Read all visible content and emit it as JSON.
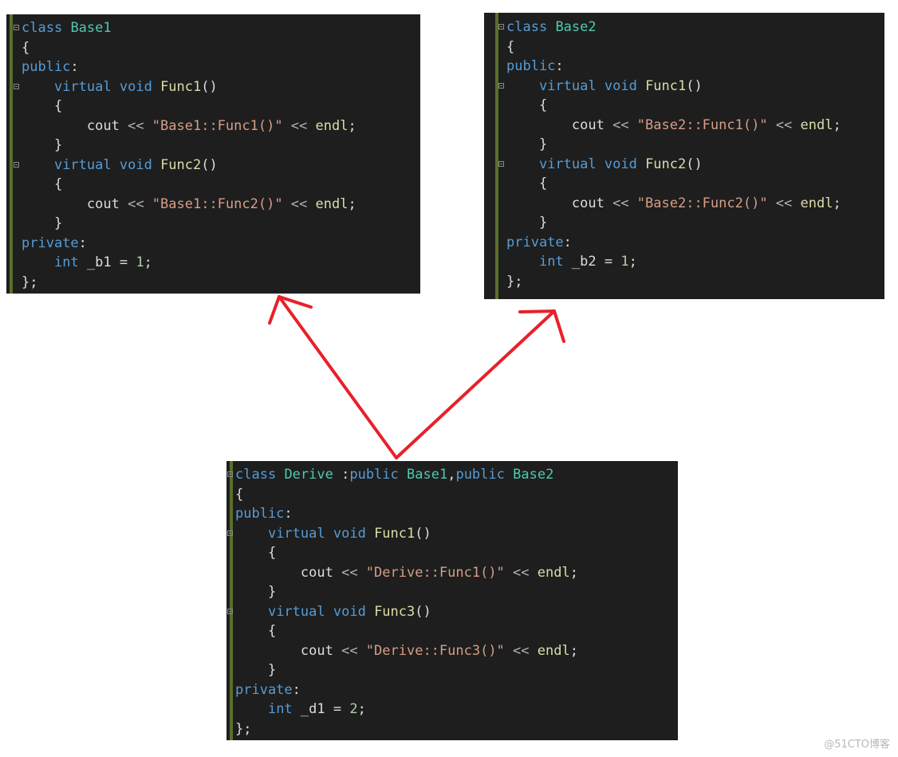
{
  "panels": [
    {
      "id": "base1",
      "lines": [
        [
          {
            "t": "class",
            "c": "kw"
          },
          {
            "t": " "
          },
          {
            "t": "Base1",
            "c": "ty"
          }
        ],
        [
          {
            "t": "{"
          }
        ],
        [
          {
            "t": "public",
            "c": "kw"
          },
          {
            "t": ":"
          }
        ],
        [
          {
            "t": "    "
          },
          {
            "t": "virtual",
            "c": "kw"
          },
          {
            "t": " "
          },
          {
            "t": "void",
            "c": "kw"
          },
          {
            "t": " "
          },
          {
            "t": "Func1",
            "c": "fn"
          },
          {
            "t": "()"
          }
        ],
        [
          {
            "t": "    {"
          }
        ],
        [
          {
            "t": "        "
          },
          {
            "t": "cout",
            "c": "id"
          },
          {
            "t": " << ",
            "c": "op"
          },
          {
            "t": "\"Base1::Func1()\"",
            "c": "str"
          },
          {
            "t": " << ",
            "c": "op"
          },
          {
            "t": "endl",
            "c": "fn"
          },
          {
            "t": ";"
          }
        ],
        [
          {
            "t": "    }"
          }
        ],
        [
          {
            "t": "    "
          },
          {
            "t": "virtual",
            "c": "kw"
          },
          {
            "t": " "
          },
          {
            "t": "void",
            "c": "kw"
          },
          {
            "t": " "
          },
          {
            "t": "Func2",
            "c": "fn"
          },
          {
            "t": "()"
          }
        ],
        [
          {
            "t": "    {"
          }
        ],
        [
          {
            "t": "        "
          },
          {
            "t": "cout",
            "c": "id"
          },
          {
            "t": " << ",
            "c": "op"
          },
          {
            "t": "\"Base1::Func2()\"",
            "c": "str"
          },
          {
            "t": " << ",
            "c": "op"
          },
          {
            "t": "endl",
            "c": "fn"
          },
          {
            "t": ";"
          }
        ],
        [
          {
            "t": "    }"
          }
        ],
        [
          {
            "t": "private",
            "c": "kw"
          },
          {
            "t": ":"
          }
        ],
        [
          {
            "t": "    "
          },
          {
            "t": "int",
            "c": "kw"
          },
          {
            "t": " _b1 = "
          },
          {
            "t": "1",
            "c": "num"
          },
          {
            "t": ";"
          }
        ],
        [
          {
            "t": "};"
          }
        ]
      ]
    },
    {
      "id": "base2",
      "lines": [
        [
          {
            "t": "class",
            "c": "kw"
          },
          {
            "t": " "
          },
          {
            "t": "Base2",
            "c": "ty"
          }
        ],
        [
          {
            "t": "{"
          }
        ],
        [
          {
            "t": "public",
            "c": "kw"
          },
          {
            "t": ":"
          }
        ],
        [
          {
            "t": "    "
          },
          {
            "t": "virtual",
            "c": "kw"
          },
          {
            "t": " "
          },
          {
            "t": "void",
            "c": "kw"
          },
          {
            "t": " "
          },
          {
            "t": "Func1",
            "c": "fn"
          },
          {
            "t": "()"
          }
        ],
        [
          {
            "t": "    {"
          }
        ],
        [
          {
            "t": "        "
          },
          {
            "t": "cout",
            "c": "id"
          },
          {
            "t": " << ",
            "c": "op"
          },
          {
            "t": "\"Base2::Func1()\"",
            "c": "str"
          },
          {
            "t": " << ",
            "c": "op"
          },
          {
            "t": "endl",
            "c": "fn"
          },
          {
            "t": ";"
          }
        ],
        [
          {
            "t": "    }"
          }
        ],
        [
          {
            "t": "    "
          },
          {
            "t": "virtual",
            "c": "kw"
          },
          {
            "t": " "
          },
          {
            "t": "void",
            "c": "kw"
          },
          {
            "t": " "
          },
          {
            "t": "Func2",
            "c": "fn"
          },
          {
            "t": "()"
          }
        ],
        [
          {
            "t": "    {"
          }
        ],
        [
          {
            "t": "        "
          },
          {
            "t": "cout",
            "c": "id"
          },
          {
            "t": " << ",
            "c": "op"
          },
          {
            "t": "\"Base2::Func2()\"",
            "c": "str"
          },
          {
            "t": " << ",
            "c": "op"
          },
          {
            "t": "endl",
            "c": "fn"
          },
          {
            "t": ";"
          }
        ],
        [
          {
            "t": "    }"
          }
        ],
        [
          {
            "t": "private",
            "c": "kw"
          },
          {
            "t": ":"
          }
        ],
        [
          {
            "t": "    "
          },
          {
            "t": "int",
            "c": "kw"
          },
          {
            "t": " _b2 = "
          },
          {
            "t": "1",
            "c": "num"
          },
          {
            "t": ";"
          }
        ],
        [
          {
            "t": "};"
          }
        ]
      ]
    },
    {
      "id": "derive",
      "lines": [
        [
          {
            "t": "class",
            "c": "kw"
          },
          {
            "t": " "
          },
          {
            "t": "Derive",
            "c": "ty"
          },
          {
            "t": " :"
          },
          {
            "t": "public",
            "c": "kw"
          },
          {
            "t": " "
          },
          {
            "t": "Base1",
            "c": "ty"
          },
          {
            "t": ","
          },
          {
            "t": "public",
            "c": "kw"
          },
          {
            "t": " "
          },
          {
            "t": "Base2",
            "c": "ty"
          }
        ],
        [
          {
            "t": "{"
          }
        ],
        [
          {
            "t": "public",
            "c": "kw"
          },
          {
            "t": ":"
          }
        ],
        [
          {
            "t": "    "
          },
          {
            "t": "virtual",
            "c": "kw"
          },
          {
            "t": " "
          },
          {
            "t": "void",
            "c": "kw"
          },
          {
            "t": " "
          },
          {
            "t": "Func1",
            "c": "fn"
          },
          {
            "t": "()"
          }
        ],
        [
          {
            "t": "    {"
          }
        ],
        [
          {
            "t": "        "
          },
          {
            "t": "cout",
            "c": "id"
          },
          {
            "t": " << ",
            "c": "op"
          },
          {
            "t": "\"Derive::Func1()\"",
            "c": "str"
          },
          {
            "t": " << ",
            "c": "op"
          },
          {
            "t": "endl",
            "c": "fn"
          },
          {
            "t": ";"
          }
        ],
        [
          {
            "t": "    }"
          }
        ],
        [
          {
            "t": "    "
          },
          {
            "t": "virtual",
            "c": "kw"
          },
          {
            "t": " "
          },
          {
            "t": "void",
            "c": "kw"
          },
          {
            "t": " "
          },
          {
            "t": "Func3",
            "c": "fn"
          },
          {
            "t": "()"
          }
        ],
        [
          {
            "t": "    {"
          }
        ],
        [
          {
            "t": "        "
          },
          {
            "t": "cout",
            "c": "id"
          },
          {
            "t": " << ",
            "c": "op"
          },
          {
            "t": "\"Derive::Func3()\"",
            "c": "str"
          },
          {
            "t": " << ",
            "c": "op"
          },
          {
            "t": "endl",
            "c": "fn"
          },
          {
            "t": ";"
          }
        ],
        [
          {
            "t": "    }"
          }
        ],
        [
          {
            "t": "private",
            "c": "kw"
          },
          {
            "t": ":"
          }
        ],
        [
          {
            "t": "    "
          },
          {
            "t": "int",
            "c": "kw"
          },
          {
            "t": " _d1 = "
          },
          {
            "t": "2",
            "c": "num"
          },
          {
            "t": ";"
          }
        ],
        [
          {
            "t": "};"
          }
        ]
      ]
    }
  ],
  "arrows": {
    "color": "#e8202a",
    "from": "derive",
    "to": [
      "base1",
      "base2"
    ],
    "meaning": "inherits from"
  },
  "watermark": "@51CTO博客"
}
